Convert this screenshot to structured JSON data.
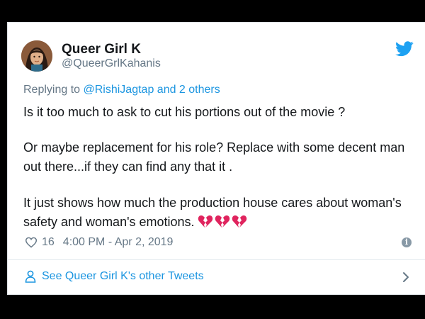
{
  "tweet": {
    "display_name": "Queer Girl K",
    "handle": "@QueerGrlKahanis",
    "replying_prefix": "Replying to ",
    "replying_targets": "@RishiJagtap and 2 others",
    "paragraphs": [
      "Is it too much to ask to cut his portions out of the movie ?",
      "Or maybe replacement for his role? Replace with some decent man out there...if they can find any that it .",
      "It just shows how much the production house cares about woman's safety and woman's emotions."
    ],
    "emoji": [
      "broken-heart",
      "broken-heart",
      "broken-heart"
    ],
    "like_count": "16",
    "timestamp": "4:00 PM - Apr 2, 2019",
    "footer_link": "See Queer Girl K's other Tweets"
  },
  "colors": {
    "link": "#1b95e0",
    "muted": "#657786",
    "text": "#14171a",
    "heart": "#e0245e"
  },
  "icons": {
    "brand": "twitter-bird-icon",
    "like": "heart-outline-icon",
    "info": "info-icon",
    "profile": "person-icon",
    "chevron": "chevron-right-icon"
  }
}
